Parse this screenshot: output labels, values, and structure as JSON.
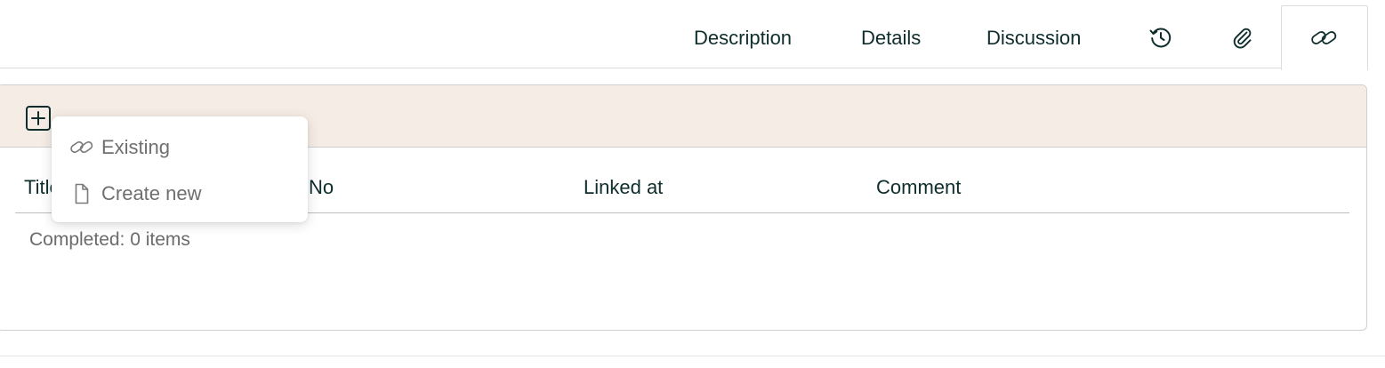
{
  "tabs": {
    "description": "Description",
    "details": "Details",
    "discussion": "Discussion",
    "icons": [
      "history-icon",
      "paperclip-icon",
      "link-icon"
    ],
    "active": "link-icon"
  },
  "table": {
    "columns": [
      "Title",
      "No",
      "Linked at",
      "Comment"
    ],
    "completed_text": "Completed: 0 items"
  },
  "add_menu": {
    "items": [
      {
        "label": "Existing",
        "icon": "link-icon"
      },
      {
        "label": "Create new",
        "icon": "document-icon"
      }
    ]
  },
  "colors": {
    "toolbar_bg": "#f5ece6",
    "text_dark": "#0f2d2d",
    "text_muted": "#6b6b6b",
    "border": "#cfcfcf"
  }
}
